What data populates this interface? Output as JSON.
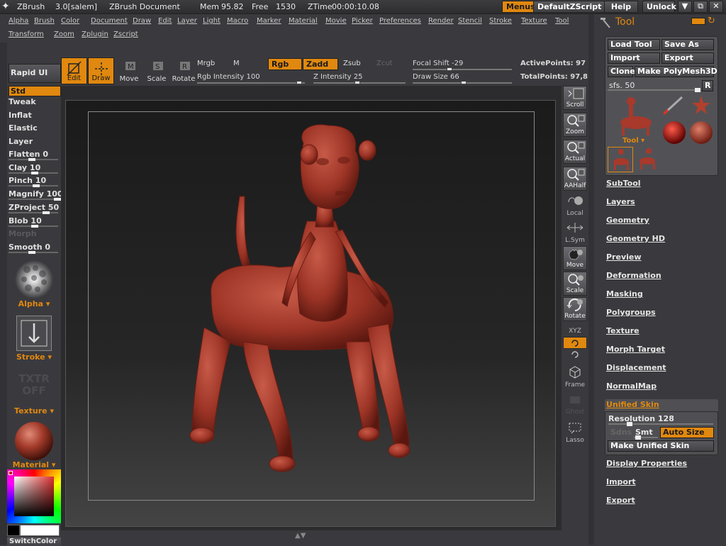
{
  "app": {
    "name": "ZBrush",
    "version": "3.0[salem]",
    "document": "ZBrush Document",
    "mem_label": "Mem",
    "mem_value": "95.82",
    "free_label": "Free",
    "free_value": "1530",
    "ztime_label": "ZTime",
    "ztime_value": "00:00:10.08"
  },
  "titlebar_buttons": {
    "menus": "Menus",
    "script": "DefaultZScript",
    "help": "Help",
    "unlock": "Unlock",
    "minimize": "▼",
    "restore": "⧉",
    "close": "✕"
  },
  "menus": {
    "row1": [
      "Alpha",
      "Brush",
      "Color",
      "Document",
      "Draw",
      "Edit",
      "Layer",
      "Light",
      "Macro",
      "Marker",
      "Material",
      "Movie",
      "Picker",
      "Preferences",
      "Render",
      "Stencil",
      "Stroke",
      "Texture",
      "Tool"
    ],
    "row2": [
      "Transform",
      "Zoom",
      "Zplugin",
      "Zscript"
    ]
  },
  "shelf": {
    "rapid_ui": "Rapid UI",
    "edit": "Edit",
    "draw": "Draw",
    "move": "Move",
    "scale": "Scale",
    "rotate": "Rotate",
    "mrgb": "Mrgb",
    "m": "M",
    "rgb": "Rgb",
    "zadd": "Zadd",
    "zsub": "Zsub",
    "zcut": "Zcut",
    "rgb_intensity": "Rgb  Intensity 100",
    "z_intensity": "Z  Intensity 25",
    "focal_shift": "Focal  Shift -29",
    "draw_size": "Draw  Size 66",
    "active_points": "ActivePoints: 97",
    "total_points": "TotalPoints: 97,8"
  },
  "brushes": [
    {
      "label": "Std",
      "selected": true
    },
    {
      "label": "Tweak"
    },
    {
      "label": "Inflat"
    },
    {
      "label": "Elastic"
    },
    {
      "label": "Layer"
    },
    {
      "label": "Flatten 0"
    },
    {
      "label": "Clay 10"
    },
    {
      "label": "Pinch 10"
    },
    {
      "label": "Magnify 100"
    },
    {
      "label": "ZProject 50"
    },
    {
      "label": "Blob 10"
    },
    {
      "label": "Morph",
      "dim": true
    },
    {
      "label": "Smooth 0"
    }
  ],
  "left_labels": {
    "alpha": "Alpha",
    "stroke": "Stroke",
    "texture_off": "TXTR OFF",
    "texture": "Texture",
    "material": "Material",
    "switch_color": "SwitchColor"
  },
  "right_strip": {
    "scroll": "Scroll",
    "zoom": "Zoom",
    "actual": "Actual",
    "aahalf": "AAHalf",
    "local": "Local",
    "lsym": "L.Sym",
    "move": "Move",
    "scale": "Scale",
    "rotate": "Rotate",
    "xyz": "XYZ",
    "frame": "Frame",
    "ghost": "Ghost",
    "lasso": "Lasso"
  },
  "tool_palette": {
    "title": "Tool",
    "load_tool": "Load Tool",
    "save_as": "Save As",
    "import": "Import",
    "export": "Export",
    "clone": "Clone",
    "make_polymesh": "Make PolyMesh3D",
    "sfs": "sfs. 50",
    "r": "R",
    "tool_label": "Tool"
  },
  "subpalettes": [
    "SubTool",
    "Layers",
    "Geometry",
    "Geometry HD",
    "Preview",
    "Deformation",
    "Masking",
    "Polygroups",
    "Texture",
    "Morph Target",
    "Displacement",
    "NormalMap"
  ],
  "unified_skin": {
    "title": "Unified Skin",
    "resolution": "Resolution 128",
    "sdns": "Sdns",
    "smt": "Smt",
    "auto_size": "Auto Size",
    "make": "Make Unified Skin"
  },
  "subpalettes_after": [
    "Display Properties",
    "Import",
    "Export"
  ],
  "colors": {
    "accent": "#e0880f",
    "panel": "#3a3a3e",
    "model": "#a8392b"
  }
}
